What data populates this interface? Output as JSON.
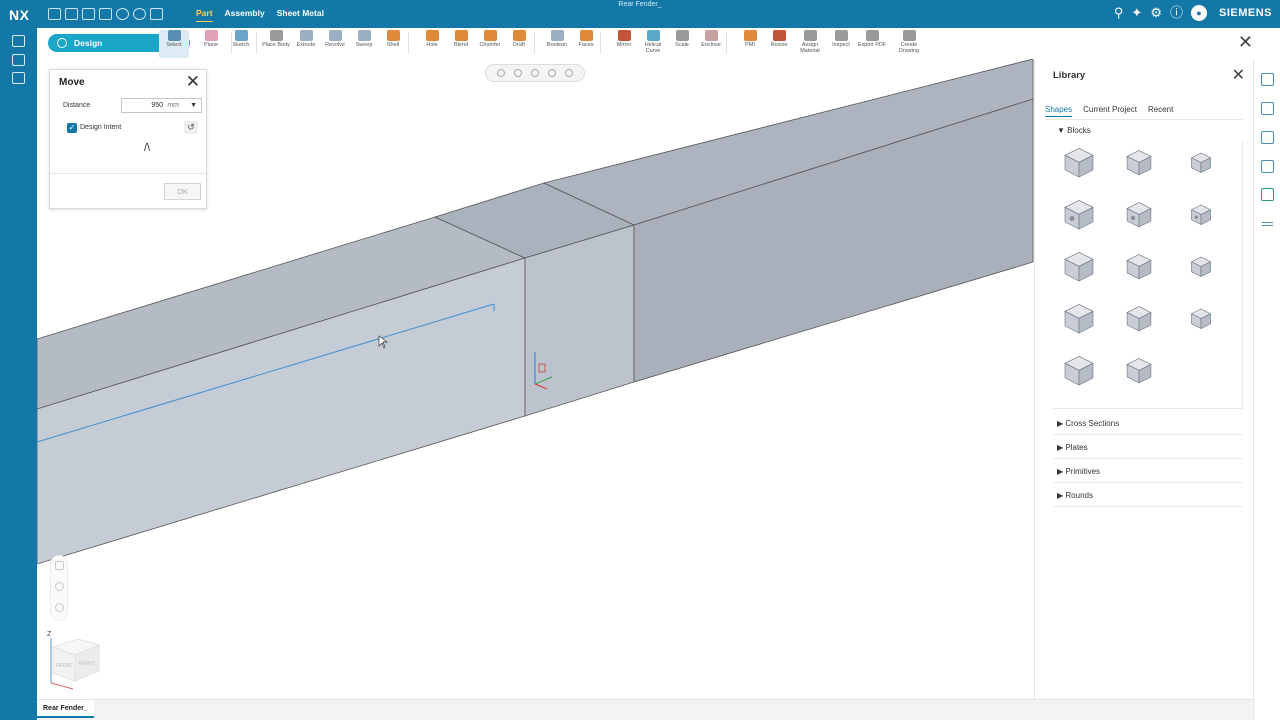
{
  "app": {
    "logo": "NX",
    "document_title": "Rear Fender_",
    "brand": "SIEMENS"
  },
  "menu_tabs": [
    {
      "label": "Part",
      "active": true
    },
    {
      "label": "Assembly",
      "active": false
    },
    {
      "label": "Sheet Metal",
      "active": false
    }
  ],
  "top_right_icons": [
    "search-icon",
    "ai-sparkle-icon",
    "gear-icon",
    "help-icon",
    "user-icon"
  ],
  "ribbon": {
    "application": "Design",
    "buttons": [
      {
        "label": "Select",
        "icon": "cursor-icon",
        "color": "#5a8fb3"
      },
      {
        "label": "Plane",
        "icon": "plane-icon",
        "color": "#e2a0b4"
      },
      {
        "label": "Sketch",
        "icon": "sketch-icon",
        "color": "#6ba4c9"
      },
      {
        "label": "Place Body",
        "icon": "place-body-icon",
        "color": "#9a9a9a"
      },
      {
        "label": "Extrude",
        "icon": "extrude-icon",
        "color": "#9ab0c2"
      },
      {
        "label": "Revolve",
        "icon": "revolve-icon",
        "color": "#9ab0c2"
      },
      {
        "label": "Sweep",
        "icon": "sweep-icon",
        "color": "#9ab0c2"
      },
      {
        "label": "Shell",
        "icon": "shell-icon",
        "color": "#e0893a"
      },
      {
        "label": "Hole",
        "icon": "hole-icon",
        "color": "#e0893a"
      },
      {
        "label": "Blend",
        "icon": "blend-icon",
        "color": "#e0893a"
      },
      {
        "label": "Chamfer",
        "icon": "chamfer-icon",
        "color": "#e0893a"
      },
      {
        "label": "Draft",
        "icon": "draft-icon",
        "color": "#e0893a"
      },
      {
        "label": "Boolean",
        "icon": "boolean-icon",
        "color": "#9ab0c2"
      },
      {
        "label": "Faces",
        "icon": "faces-icon",
        "color": "#e0893a"
      },
      {
        "label": "Mirror",
        "icon": "mirror-icon",
        "color": "#c0553a"
      },
      {
        "label": "Helical Curve",
        "icon": "helical-curve-icon",
        "color": "#5aa9c9"
      },
      {
        "label": "Scale",
        "icon": "scale-icon",
        "color": "#9a9a9a"
      },
      {
        "label": "Enclose",
        "icon": "enclose-icon",
        "color": "#c9a0a0"
      },
      {
        "label": "PMI",
        "icon": "pmi-icon",
        "color": "#e0893a"
      },
      {
        "label": "Resize",
        "icon": "resize-icon",
        "color": "#c0553a"
      },
      {
        "label": "Assign Material",
        "icon": "material-icon",
        "color": "#9a9a9a"
      },
      {
        "label": "Inspect",
        "icon": "inspect-icon",
        "color": "#9a9a9a"
      },
      {
        "label": "Export PDF",
        "icon": "export-pdf-icon",
        "color": "#9a9a9a"
      },
      {
        "label": "Create Drawing",
        "icon": "drawing-icon",
        "color": "#9a9a9a"
      }
    ]
  },
  "move_dialog": {
    "title": "Move",
    "distance_label": "Distance",
    "distance_value": "950",
    "distance_unit": "mm",
    "design_intent_label": "Design Intent",
    "design_intent_checked": true,
    "intent_symbol": "/\\",
    "ok_label": "OK"
  },
  "view_cube": {
    "face_left": "FRONT",
    "face_right": "RIGHT",
    "z_label": "Z"
  },
  "library": {
    "title": "Library",
    "tabs": [
      {
        "label": "Shapes",
        "active": true
      },
      {
        "label": "Current Project",
        "active": false
      },
      {
        "label": "Recent",
        "active": false
      }
    ],
    "expanded_section": "Blocks",
    "shapes": [
      "block-large-icon",
      "block-medium-icon",
      "block-small-icon",
      "rounded-block-hole-large-icon",
      "rounded-block-hole-medium-icon",
      "rounded-block-hole-small-icon",
      "rounded-block-large-icon",
      "rounded-block-medium-icon",
      "rounded-block-small-icon",
      "step-block-icon",
      "slot-block-icon",
      "u-block-icon",
      "chamfer-block-icon",
      "wedge-block-icon"
    ],
    "collapsed_sections": [
      "Cross Sections",
      "Plates",
      "Primitives",
      "Rounds"
    ]
  },
  "document_tab": "Rear Fender_",
  "colors": {
    "brand": "#1378a8",
    "ribbon_accent": "#1aa6c9",
    "active_tab": "#ffd24a",
    "edge_highlight": "#3d8fd1",
    "model_face": "#b7bec8"
  }
}
